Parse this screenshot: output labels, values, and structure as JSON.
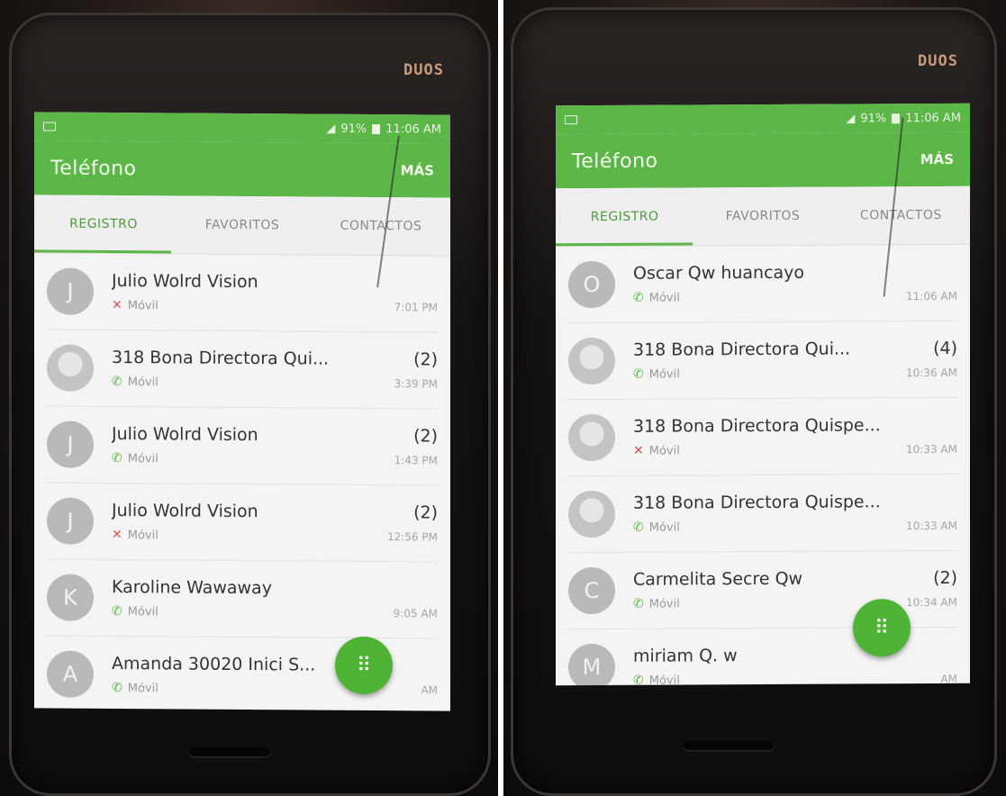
{
  "screens": [
    {
      "status": {
        "battery": "91%",
        "time": "11:06 AM"
      },
      "app_title": "Teléfono",
      "more_label": "MÁS",
      "tabs": [
        "REGISTRO",
        "FAVORITOS",
        "CONTACTOS"
      ],
      "active_tab": 0,
      "entries": [
        {
          "initial": "J",
          "name": "Julio Wolrd Vision",
          "count": "",
          "type": "Móvil",
          "call": "missed",
          "time": "7:01 PM",
          "avatar": "letter"
        },
        {
          "initial": "",
          "name": "318 Bona Directora Qui...",
          "count": "(2)",
          "type": "Móvil",
          "call": "incoming",
          "time": "3:39 PM",
          "avatar": "photo"
        },
        {
          "initial": "J",
          "name": "Julio Wolrd Vision",
          "count": "(2)",
          "type": "Móvil",
          "call": "incoming",
          "time": "1:43 PM",
          "avatar": "letter"
        },
        {
          "initial": "J",
          "name": "Julio Wolrd Vision",
          "count": "(2)",
          "type": "Móvil",
          "call": "missed",
          "time": "12:56 PM",
          "avatar": "letter"
        },
        {
          "initial": "K",
          "name": "Karoline Wawaway",
          "count": "",
          "type": "Móvil",
          "call": "incoming",
          "time": "9:05 AM",
          "avatar": "letter"
        },
        {
          "initial": "A",
          "name": "Amanda 30020 Inici S...",
          "count": "",
          "type": "Móvil",
          "call": "incoming",
          "time": "AM",
          "avatar": "letter"
        }
      ]
    },
    {
      "status": {
        "battery": "91%",
        "time": "11:06 AM"
      },
      "app_title": "Teléfono",
      "more_label": "MÁS",
      "tabs": [
        "REGISTRO",
        "FAVORITOS",
        "CONTACTOS"
      ],
      "active_tab": 0,
      "entries": [
        {
          "initial": "O",
          "name": "Oscar Qw huancayo",
          "count": "",
          "type": "Móvil",
          "call": "incoming",
          "time": "11:06 AM",
          "avatar": "letter"
        },
        {
          "initial": "",
          "name": "318 Bona Directora Qui...",
          "count": "(4)",
          "type": "Móvil",
          "call": "outgoing",
          "time": "10:36 AM",
          "avatar": "photo"
        },
        {
          "initial": "",
          "name": "318 Bona Directora Quispe...",
          "count": "",
          "type": "Móvil",
          "call": "missed",
          "time": "10:33 AM",
          "avatar": "photo"
        },
        {
          "initial": "",
          "name": "318 Bona Directora Quispe...",
          "count": "",
          "type": "Móvil",
          "call": "incoming",
          "time": "10:33 AM",
          "avatar": "photo"
        },
        {
          "initial": "C",
          "name": "Carmelita Secre Qw",
          "count": "(2)",
          "type": "Móvil",
          "call": "incoming",
          "time": "10:34 AM",
          "avatar": "letter"
        },
        {
          "initial": "M",
          "name": "miriam Q. w",
          "count": "",
          "type": "Móvil",
          "call": "incoming",
          "time": "AM",
          "avatar": "letter"
        }
      ]
    }
  ],
  "brand_label": "DUOS",
  "colors": {
    "accent": "#5cb648",
    "missed": "#e05050"
  },
  "icons": {
    "fab": "dialpad-icon",
    "missed": "missed-call-icon",
    "incoming": "incoming-call-icon"
  }
}
